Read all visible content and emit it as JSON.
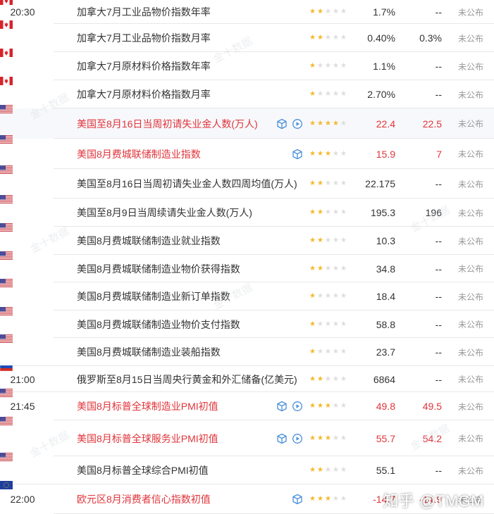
{
  "watermark_text": "金十数据",
  "zhihu_mark": "知乎 @TMGM",
  "colors": {
    "star_on": "#f5b82a",
    "star_off": "#dddddd",
    "red": "#e0343a",
    "muted": "#999999"
  },
  "rows": [
    {
      "time": "20:30",
      "flag": "canada",
      "name": "加拿大7月工业品物价指数年率",
      "red": false,
      "icons": [],
      "stars": 2,
      "actual": "1.7%",
      "forecast": "--",
      "previous": "未公布",
      "actual_red": false,
      "forecast_red": false
    },
    {
      "time": "",
      "flag": "canada",
      "name": "加拿大7月工业品物价指数月率",
      "red": false,
      "icons": [],
      "stars": 2,
      "actual": "0.40%",
      "forecast": "0.3%",
      "previous": "未公布",
      "actual_red": false,
      "forecast_red": false
    },
    {
      "time": "",
      "flag": "canada",
      "name": "加拿大7月原材料价格指数年率",
      "red": false,
      "icons": [],
      "stars": 1,
      "actual": "1.1%",
      "forecast": "--",
      "previous": "未公布",
      "actual_red": false,
      "forecast_red": false
    },
    {
      "time": "",
      "flag": "canada",
      "name": "加拿大7月原材料价格指数月率",
      "red": false,
      "icons": [],
      "stars": 1,
      "actual": "2.70%",
      "forecast": "--",
      "previous": "未公布",
      "actual_red": false,
      "forecast_red": false
    },
    {
      "time": "",
      "flag": "usa",
      "name": "美国至8月16日当周初请失业金人数(万人)",
      "red": true,
      "icons": [
        "cube",
        "play"
      ],
      "stars": 4,
      "actual": "22.4",
      "forecast": "22.5",
      "previous": "未公布",
      "actual_red": true,
      "forecast_red": true
    },
    {
      "time": "",
      "flag": "usa",
      "name": "美国8月费城联储制造业指数",
      "red": true,
      "icons": [
        "cube"
      ],
      "stars": 3,
      "actual": "15.9",
      "forecast": "7",
      "previous": "未公布",
      "actual_red": true,
      "forecast_red": true
    },
    {
      "time": "",
      "flag": "usa",
      "name": "美国至8月16日当周初请失业金人数四周均值(万人)",
      "red": false,
      "icons": [],
      "stars": 2,
      "actual": "22.175",
      "forecast": "--",
      "previous": "未公布",
      "actual_red": false,
      "forecast_red": false
    },
    {
      "time": "",
      "flag": "usa",
      "name": "美国至8月9日当周续请失业金人数(万人)",
      "red": false,
      "icons": [],
      "stars": 2,
      "actual": "195.3",
      "forecast": "196",
      "previous": "未公布",
      "actual_red": false,
      "forecast_red": false
    },
    {
      "time": "",
      "flag": "usa",
      "name": "美国8月费城联储制造业就业指数",
      "red": false,
      "icons": [],
      "stars": 2,
      "actual": "10.3",
      "forecast": "--",
      "previous": "未公布",
      "actual_red": false,
      "forecast_red": false
    },
    {
      "time": "",
      "flag": "usa",
      "name": "美国8月费城联储制造业物价获得指数",
      "red": false,
      "icons": [],
      "stars": 2,
      "actual": "34.8",
      "forecast": "--",
      "previous": "未公布",
      "actual_red": false,
      "forecast_red": false
    },
    {
      "time": "",
      "flag": "usa",
      "name": "美国8月费城联储制造业新订单指数",
      "red": false,
      "icons": [],
      "stars": 1,
      "actual": "18.4",
      "forecast": "--",
      "previous": "未公布",
      "actual_red": false,
      "forecast_red": false
    },
    {
      "time": "",
      "flag": "usa",
      "name": "美国8月费城联储制造业物价支付指数",
      "red": false,
      "icons": [],
      "stars": 1,
      "actual": "58.8",
      "forecast": "--",
      "previous": "未公布",
      "actual_red": false,
      "forecast_red": false
    },
    {
      "time": "",
      "flag": "usa",
      "name": "美国8月费城联储制造业装船指数",
      "red": false,
      "icons": [],
      "stars": 1,
      "actual": "23.7",
      "forecast": "--",
      "previous": "未公布",
      "actual_red": false,
      "forecast_red": false
    },
    {
      "time": "21:00",
      "flag": "russia",
      "name": "俄罗斯至8月15日当周央行黄金和外汇储备(亿美元)",
      "red": false,
      "icons": [],
      "stars": 2,
      "actual": "6864",
      "forecast": "--",
      "previous": "未公布",
      "actual_red": false,
      "forecast_red": false
    },
    {
      "time": "21:45",
      "flag": "usa",
      "name": "美国8月标普全球制造业PMI初值",
      "red": true,
      "icons": [
        "cube",
        "play"
      ],
      "stars": 3,
      "actual": "49.8",
      "forecast": "49.5",
      "previous": "未公布",
      "actual_red": true,
      "forecast_red": true
    },
    {
      "time": "",
      "flag": "usa",
      "name": "美国8月标普全球服务业PMI初值",
      "red": true,
      "icons": [
        "cube",
        "play"
      ],
      "stars": 3,
      "actual": "55.7",
      "forecast": "54.2",
      "previous": "未公布",
      "actual_red": true,
      "forecast_red": true
    },
    {
      "time": "",
      "flag": "usa",
      "name": "美国8月标普全球综合PMI初值",
      "red": false,
      "icons": [],
      "stars": 2,
      "actual": "55.1",
      "forecast": "--",
      "previous": "未公布",
      "actual_red": false,
      "forecast_red": false
    },
    {
      "time": "22:00",
      "flag": "eu",
      "name": "欧元区8月消费者信心指数初值",
      "red": true,
      "icons": [
        "cube"
      ],
      "stars": 3,
      "actual": "-14.7",
      "forecast": "-14.9",
      "previous": "未公布",
      "actual_red": true,
      "forecast_red": true
    }
  ]
}
